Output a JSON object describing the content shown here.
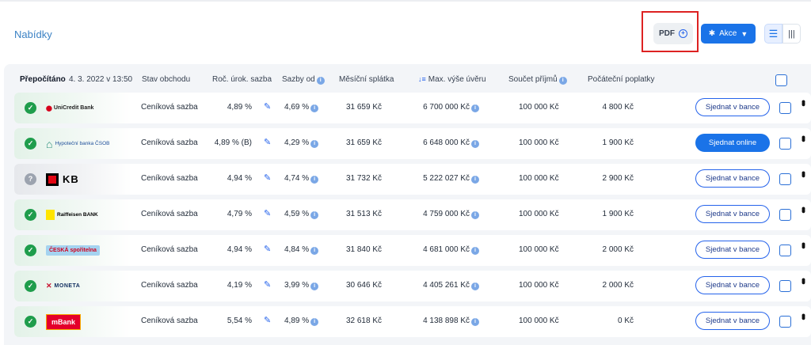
{
  "header": {
    "title": "Nabídky",
    "pdf_label": "PDF",
    "pdf_icon": "plus-circle-icon",
    "akce_label": "Akce",
    "view_list_icon": "list-view-icon",
    "view_columns_icon": "columns-view-icon"
  },
  "table": {
    "recalc_label": "Přepočítáno",
    "recalc_date": "4. 3. 2022 v 13:50",
    "columns": {
      "stav": "Stav obchodu",
      "sazba": "Roč. úrok. sazba",
      "sazby_od": "Sazby od",
      "splatka": "Měsíční splátka",
      "max_vyse": "Max. výše úvěru",
      "prijmy": "Součet příjmů",
      "poplatky": "Počáteční poplatky"
    },
    "rows": [
      {
        "bank": "UniCredit Bank",
        "status": "ok",
        "stav": "Ceníková sazba",
        "sazba": "4,89 %",
        "sazby_od": "4,69 %",
        "splatka": "31 659 Kč",
        "max_vyse": "6 700 000 Kč",
        "prijmy": "100 000 Kč",
        "poplatky": "4 800 Kč",
        "action": "Sjednat v bance",
        "primary": false
      },
      {
        "bank": "Hypoteční banka ČSOB",
        "status": "ok",
        "stav": "Ceníková sazba",
        "sazba": "4,89 % (B)",
        "sazby_od": "4,29 %",
        "splatka": "31 659 Kč",
        "max_vyse": "6 648 000 Kč",
        "prijmy": "100 000 Kč",
        "poplatky": "1 900 Kč",
        "action": "Sjednat online",
        "primary": true
      },
      {
        "bank": "KB",
        "status": "unknown",
        "stav": "Ceníková sazba",
        "sazba": "4,94 %",
        "sazby_od": "4,74 %",
        "splatka": "31 732 Kč",
        "max_vyse": "5 222 027 Kč",
        "prijmy": "100 000 Kč",
        "poplatky": "2 900 Kč",
        "action": "Sjednat v bance",
        "primary": false
      },
      {
        "bank": "Raiffeisen BANK",
        "status": "ok",
        "stav": "Ceníková sazba",
        "sazba": "4,79 %",
        "sazby_od": "4,59 %",
        "splatka": "31 513 Kč",
        "max_vyse": "4 759 000 Kč",
        "prijmy": "100 000 Kč",
        "poplatky": "1 900 Kč",
        "action": "Sjednat v bance",
        "primary": false
      },
      {
        "bank": "ČESKÁ spořitelna",
        "status": "ok",
        "stav": "Ceníková sazba",
        "sazba": "4,94 %",
        "sazby_od": "4,84 %",
        "splatka": "31 840 Kč",
        "max_vyse": "4 681 000 Kč",
        "prijmy": "100 000 Kč",
        "poplatky": "2 000 Kč",
        "action": "Sjednat v bance",
        "primary": false
      },
      {
        "bank": "MONETA",
        "status": "ok",
        "stav": "Ceníková sazba",
        "sazba": "4,19 %",
        "sazby_od": "3,99 %",
        "splatka": "30 646 Kč",
        "max_vyse": "4 405 261 Kč",
        "prijmy": "100 000 Kč",
        "poplatky": "2 000 Kč",
        "action": "Sjednat v bance",
        "primary": false
      },
      {
        "bank": "mBank",
        "status": "ok",
        "stav": "Ceníková sazba",
        "sazba": "5,54 %",
        "sazby_od": "4,89 %",
        "splatka": "32 618 Kč",
        "max_vyse": "4 138 898 Kč",
        "prijmy": "100 000 Kč",
        "poplatky": "0 Kč",
        "action": "Sjednat v bance",
        "primary": false
      }
    ]
  },
  "colors": {
    "accent": "#1a73e8",
    "ok_status": "#1f9d4c",
    "unknown_status": "#9ca3af",
    "highlight": "#dd2222"
  }
}
